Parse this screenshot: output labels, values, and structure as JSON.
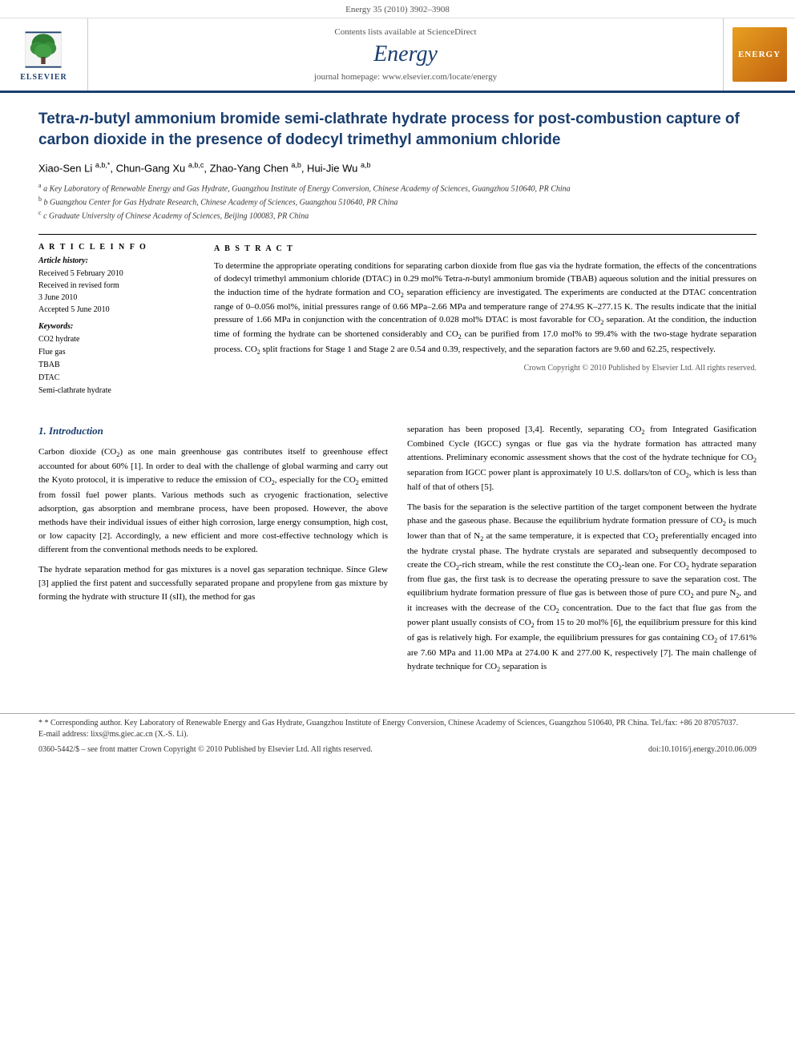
{
  "topbar": {
    "text": "Energy 35 (2010) 3902–3908"
  },
  "journal_header": {
    "sciencedirect_text": "Contents lists available at ScienceDirect",
    "sciencedirect_link": "ScienceDirect",
    "journal_name": "Energy",
    "homepage_text": "journal homepage: www.elsevier.com/locate/energy",
    "homepage_link": "www.elsevier.com/locate/energy",
    "elsevier_label": "ELSEVIER",
    "badge_text": "ENERGY"
  },
  "article": {
    "title": "Tetra-n-butyl ammonium bromide semi-clathrate hydrate process for post-combustion capture of carbon dioxide in the presence of dodecyl trimethyl ammonium chloride",
    "authors": "Xiao-Sen Li a,b,*, Chun-Gang Xu a,b,c, Zhao-Yang Chen a,b, Hui-Jie Wu a,b",
    "affiliations": [
      "a Key Laboratory of Renewable Energy and Gas Hydrate, Guangzhou Institute of Energy Conversion, Chinese Academy of Sciences, Guangzhou 510640, PR China",
      "b Guangzhou Center for Gas Hydrate Research, Chinese Academy of Sciences, Guangzhou 510640, PR China",
      "c Graduate University of Chinese Academy of Sciences, Beijing 100083, PR China"
    ],
    "article_info": {
      "section_title": "A R T I C L E   I N F O",
      "history_title": "Article history:",
      "history_lines": [
        "Received 5 February 2010",
        "Received in revised form",
        "3 June 2010",
        "Accepted 5 June 2010"
      ],
      "keywords_title": "Keywords:",
      "keywords": [
        "CO2 hydrate",
        "Flue gas",
        "TBAB",
        "DTAC",
        "Semi-clathrate hydrate"
      ]
    },
    "abstract": {
      "section_title": "A B S T R A C T",
      "text": "To determine the appropriate operating conditions for separating carbon dioxide from flue gas via the hydrate formation, the effects of the concentrations of dodecyl trimethyl ammonium chloride (DTAC) in 0.29 mol% Tetra-n-butyl ammonium bromide (TBAB) aqueous solution and the initial pressures on the induction time of the hydrate formation and CO2 separation efficiency are investigated. The experiments are conducted at the DTAC concentration range of 0–0.056 mol%, initial pressures range of 0.66 MPa–2.66 MPa and temperature range of 274.95 K–277.15 K. The results indicate that the initial pressure of 1.66 MPa in conjunction with the concentration of 0.028 mol% DTAC is most favorable for CO2 separation. At the condition, the induction time of forming the hydrate can be shortened considerably and CO2 can be purified from 17.0 mol% to 99.4% with the two-stage hydrate separation process. CO2 split fractions for Stage 1 and Stage 2 are 0.54 and 0.39, respectively, and the separation factors are 9.60 and 62.25, respectively.",
      "copyright": "Crown Copyright © 2010 Published by Elsevier Ltd. All rights reserved."
    }
  },
  "body": {
    "section1": {
      "number": "1.",
      "title": "Introduction",
      "paragraphs": [
        "Carbon dioxide (CO2) as one main greenhouse gas contributes itself to greenhouse effect accounted for about 60% [1]. In order to deal with the challenge of global warming and carry out the Kyoto protocol, it is imperative to reduce the emission of CO2, especially for the CO2 emitted from fossil fuel power plants. Various methods such as cryogenic fractionation, selective adsorption, gas absorption and membrane process, have been proposed. However, the above methods have their individual issues of either high corrosion, large energy consumption, high cost, or low capacity [2]. Accordingly, a new efficient and more cost-effective technology which is different from the conventional methods needs to be explored.",
        "The hydrate separation method for gas mixtures is a novel gas separation technique. Since Glew [3] applied the first patent and successfully separated propane and propylene from gas mixture by forming the hydrate with structure II (sII), the method for gas"
      ]
    },
    "section1_right": {
      "paragraphs": [
        "separation has been proposed [3,4]. Recently, separating CO2 from Integrated Gasification Combined Cycle (IGCC) syngas or flue gas via the hydrate formation has attracted many attentions. Preliminary economic assessment shows that the cost of the hydrate technique for CO2 separation from IGCC power plant is approximately 10 U.S. dollars/ton of CO2, which is less than half of that of others [5].",
        "The basis for the separation is the selective partition of the target component between the hydrate phase and the gaseous phase. Because the equilibrium hydrate formation pressure of CO2 is much lower than that of N2 at the same temperature, it is expected that CO2 preferentially encaged into the hydrate crystal phase. The hydrate crystals are separated and subsequently decomposed to create the CO2-rich stream, while the rest constitute the CO2-lean one. For CO2 hydrate separation from flue gas, the first task is to decrease the operating pressure to save the separation cost. The equilibrium hydrate formation pressure of flue gas is between those of pure CO2 and pure N2, and it increases with the decrease of the CO2 concentration. Due to the fact that flue gas from the power plant usually consists of CO2 from 15 to 20 mol% [6], the equilibrium pressure for this kind of gas is relatively high. For example, the equilibrium pressures for gas containing CO2 of 17.61% are 7.60 MPa and 11.00 MPa at 274.00 K and 277.00 K, respectively [7]. The main challenge of hydrate technique for CO2 separation is"
      ]
    }
  },
  "footer": {
    "footnote": "* Corresponding author. Key Laboratory of Renewable Energy and Gas Hydrate, Guangzhou Institute of Energy Conversion, Chinese Academy of Sciences, Guangzhou 510640, PR China. Tel./fax: +86 20 87057037.",
    "email_label": "E-mail address:",
    "email": "lixs@ms.giec.ac.cn (X.-S. Li).",
    "issn": "0360-5442/$ – see front matter Crown Copyright © 2010 Published by Elsevier Ltd. All rights reserved.",
    "doi": "doi:10.1016/j.energy.2010.06.009"
  }
}
